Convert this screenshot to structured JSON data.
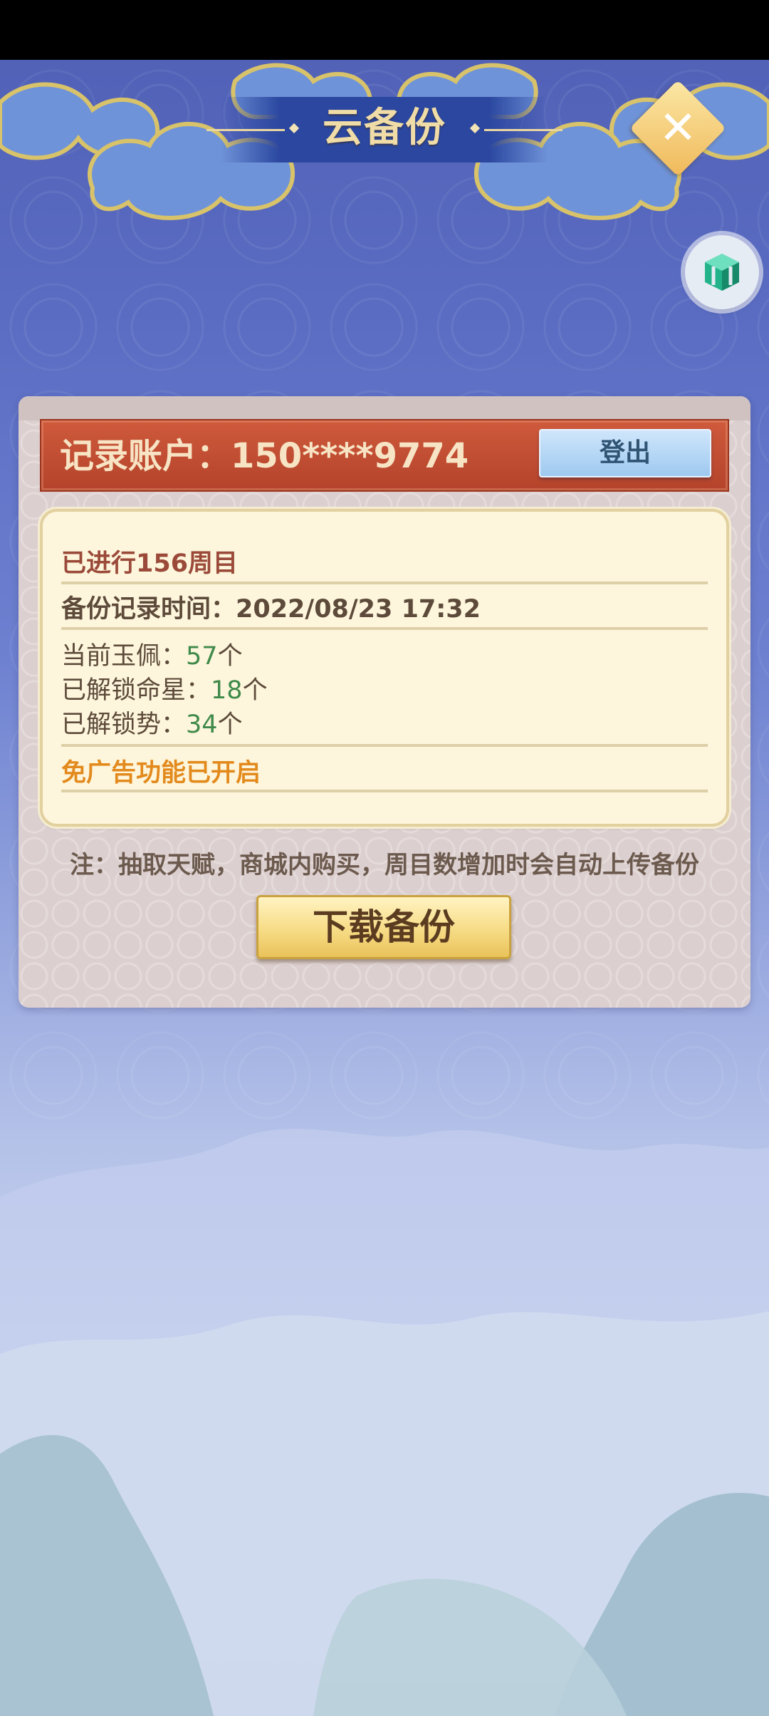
{
  "header": {
    "title": "云备份"
  },
  "account": {
    "label": "记录账户：150****9774",
    "logout_label": "登出"
  },
  "info": {
    "cycles": "已进行156周目",
    "backup_time": "备份记录时间：2022/08/23 17:32",
    "jade_label": "当前玉佩：",
    "jade_value": "57",
    "jade_unit": "个",
    "star_label": "已解锁命星：",
    "star_value": "18",
    "star_unit": "个",
    "power_label": "已解锁势：",
    "power_value": "34",
    "power_unit": "个",
    "no_ads": "免广告功能已开启"
  },
  "note": "注：抽取天赋，商城内购买，周目数增加时会自动上传备份",
  "download_label": "下载备份",
  "colors": {
    "accent_green": "#3f8a4a",
    "account_red": "#c04b30",
    "no_ads_orange": "#e38a1d"
  }
}
